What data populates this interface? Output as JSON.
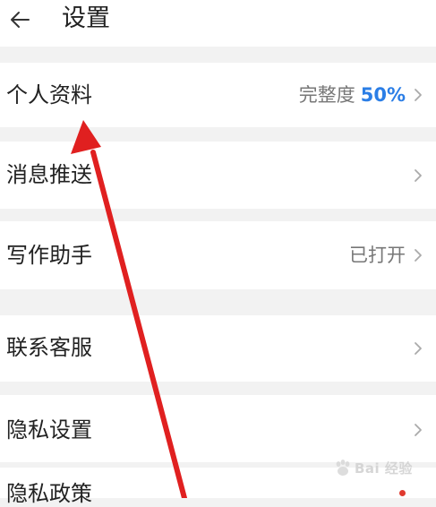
{
  "header": {
    "title": "设置",
    "back_icon": "back-arrow-icon"
  },
  "rows": [
    {
      "label": "个人资料",
      "value_prefix": "完整度",
      "value_pct": "50%",
      "chevron": true
    },
    {
      "label": "消息推送",
      "chevron": true
    },
    {
      "label": "写作助手",
      "value": "已打开",
      "chevron": true
    },
    {
      "label": "联系客服",
      "chevron": true
    },
    {
      "label": "隐私设置",
      "chevron": true
    },
    {
      "label": "隐私政策",
      "badge": "red-dot"
    }
  ],
  "annotation": {
    "type": "red-arrow",
    "color": "#e02020",
    "points_to": "个人资料"
  },
  "watermark": {
    "text": "Bai 经验",
    "icon": "paw-icon"
  },
  "colors": {
    "background": "#f2f2f2",
    "card": "#ffffff",
    "accent": "#2b7ee6",
    "badge": "#e03a2f"
  }
}
